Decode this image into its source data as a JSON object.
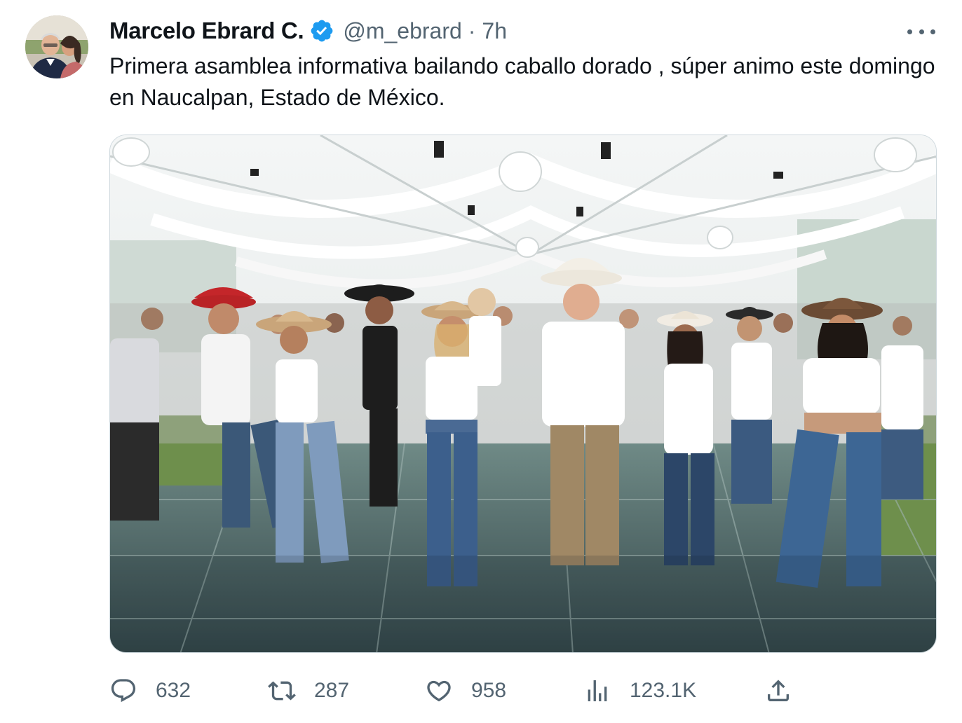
{
  "author": {
    "display_name": "Marcelo Ebrard C.",
    "handle": "@m_ebrard",
    "separator": "·",
    "time": "7h",
    "verified": true
  },
  "tweet": {
    "text": "Primera asamblea informativa bailando caballo dorado , súper animo este domingo en Naucalpan, Estado de México."
  },
  "media": {
    "type": "photo"
  },
  "actions": {
    "replies": "632",
    "retweets": "287",
    "likes": "958",
    "views": "123.1K"
  },
  "icons": {
    "reply": "reply-icon",
    "retweet": "retweet-icon",
    "like": "heart-icon",
    "views": "views-icon",
    "share": "share-icon",
    "more": "more-icon",
    "verified": "verified-badge-icon"
  },
  "colors": {
    "text_primary": "#0f1419",
    "text_secondary": "#536471",
    "verified": "#1d9bf0",
    "border": "#cfd9de"
  }
}
